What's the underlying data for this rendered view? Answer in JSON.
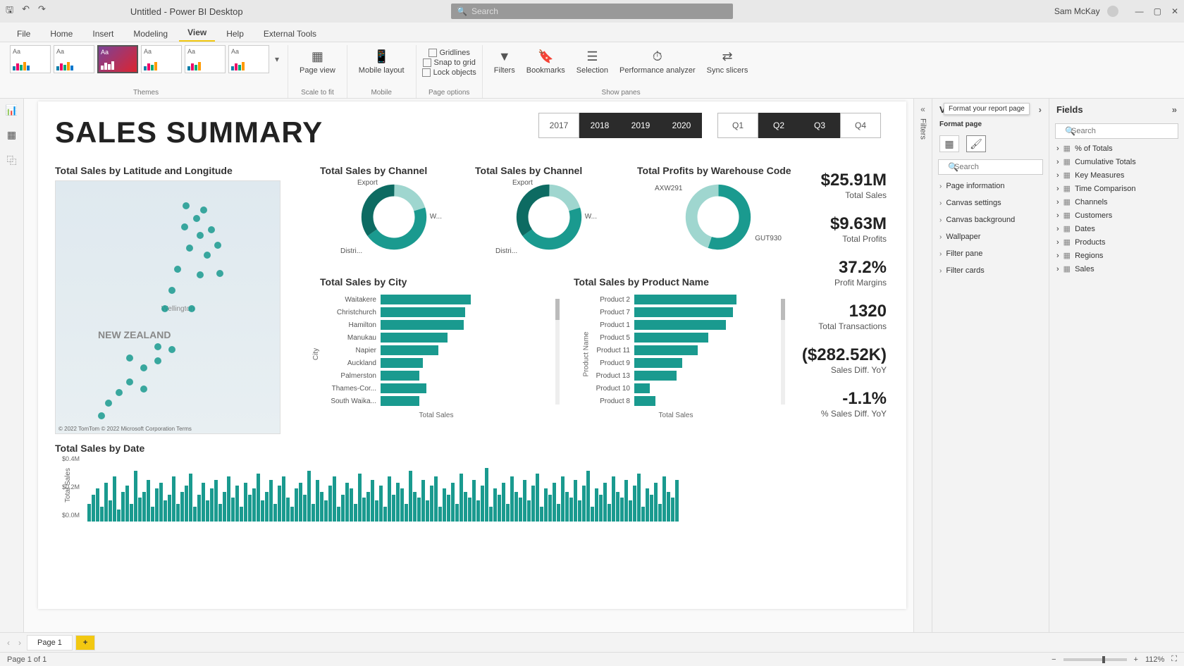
{
  "titlebar": {
    "title": "Untitled - Power BI Desktop",
    "search_placeholder": "Search",
    "user": "Sam McKay"
  },
  "menubar": {
    "tabs": [
      "File",
      "Home",
      "Insert",
      "Modeling",
      "View",
      "Help",
      "External Tools"
    ],
    "active": "View"
  },
  "ribbon": {
    "themes_label": "Themes",
    "page_view": "Page view",
    "scale_label": "Scale to fit",
    "mobile_layout": "Mobile layout",
    "mobile_label": "Mobile",
    "gridlines": "Gridlines",
    "snap": "Snap to grid",
    "lock": "Lock objects",
    "page_options_label": "Page options",
    "filters": "Filters",
    "bookmarks": "Bookmarks",
    "selection": "Selection",
    "perf": "Performance analyzer",
    "sync": "Sync slicers",
    "show_panes_label": "Show panes"
  },
  "report": {
    "title": "SALES SUMMARY",
    "years": [
      "2017",
      "2018",
      "2019",
      "2020"
    ],
    "years_active": [
      "2018",
      "2019",
      "2020"
    ],
    "quarters": [
      "Q1",
      "Q2",
      "Q3",
      "Q4"
    ],
    "quarters_active": [
      "Q2",
      "Q3"
    ],
    "map_title": "Total Sales by Latitude and Longitude",
    "map_country": "NEW ZEALAND",
    "map_city": "Wellington",
    "map_attrib": "© 2022 TomTom  © 2022 Microsoft Corporation  Terms",
    "donut1": {
      "title": "Total Sales by Channel",
      "labels": [
        "Export",
        "W...",
        "Distri..."
      ]
    },
    "donut2": {
      "title": "Total Sales by Channel",
      "labels": [
        "Export",
        "W...",
        "Distri..."
      ]
    },
    "donut3": {
      "title": "Total Profits by Warehouse Code",
      "labels": [
        "AXW291",
        "GUT930"
      ]
    },
    "kpis": [
      {
        "val": "$25.91M",
        "lbl": "Total Sales"
      },
      {
        "val": "$9.63M",
        "lbl": "Total Profits"
      },
      {
        "val": "37.2%",
        "lbl": "Profit Margins"
      },
      {
        "val": "1320",
        "lbl": "Total Transactions"
      },
      {
        "val": "($282.52K)",
        "lbl": "Sales Diff. YoY"
      },
      {
        "val": "-1.1%",
        "lbl": "% Sales Diff. YoY"
      }
    ],
    "city_title": "Total Sales by City",
    "city_axis_v": "City",
    "city_axis_h": "Total Sales",
    "product_title": "Total Sales by Product Name",
    "product_axis_v": "Product Name",
    "product_axis_h": "Total Sales",
    "date_title": "Total Sales by Date",
    "date_axis_v": "Total Sales",
    "date_yticks": [
      "$0.4M",
      "$0.2M",
      "$0.0M"
    ]
  },
  "chart_data": {
    "city_bars": {
      "type": "bar",
      "orientation": "horizontal",
      "categories": [
        "Waitakere",
        "Christchurch",
        "Hamilton",
        "Manukau",
        "Napier",
        "Auckland",
        "Palmerston",
        "Thames-Cor...",
        "South Waika..."
      ],
      "values": [
        128,
        120,
        118,
        95,
        82,
        60,
        55,
        65,
        55
      ],
      "xlabel": "Total Sales",
      "ylabel": "City"
    },
    "product_bars": {
      "type": "bar",
      "orientation": "horizontal",
      "categories": [
        "Product 2",
        "Product 7",
        "Product 1",
        "Product 5",
        "Product 11",
        "Product 9",
        "Product 13",
        "Product 10",
        "Product 8"
      ],
      "values": [
        145,
        140,
        130,
        105,
        90,
        68,
        60,
        22,
        30
      ],
      "xlabel": "Total Sales",
      "ylabel": "Product Name"
    },
    "donut_channel": {
      "type": "pie",
      "categories": [
        "Export",
        "Wholesale",
        "Distributor"
      ],
      "values": [
        20,
        45,
        35
      ]
    },
    "donut_warehouse": {
      "type": "pie",
      "categories": [
        "AXW291",
        "GUT930"
      ],
      "values": [
        55,
        45
      ]
    },
    "date_columns": {
      "type": "bar",
      "title": "Total Sales by Date",
      "ylabel": "Total Sales",
      "ylim": [
        0,
        0.4
      ],
      "y_unit": "$M",
      "values": [
        0.12,
        0.18,
        0.22,
        0.1,
        0.26,
        0.14,
        0.3,
        0.08,
        0.2,
        0.24,
        0.12,
        0.34,
        0.16,
        0.2,
        0.28,
        0.1,
        0.22,
        0.26,
        0.14,
        0.18,
        0.3,
        0.12,
        0.2,
        0.24,
        0.32,
        0.1,
        0.18,
        0.26,
        0.14,
        0.22,
        0.28,
        0.12,
        0.2,
        0.3,
        0.16,
        0.24,
        0.1,
        0.26,
        0.18,
        0.22,
        0.32,
        0.14,
        0.2,
        0.28,
        0.12,
        0.24,
        0.3,
        0.16,
        0.1,
        0.22,
        0.26,
        0.18,
        0.34,
        0.12,
        0.28,
        0.2,
        0.14,
        0.24,
        0.3,
        0.1,
        0.18,
        0.26,
        0.22,
        0.12,
        0.32,
        0.16,
        0.2,
        0.28,
        0.14,
        0.24,
        0.1,
        0.3,
        0.18,
        0.26,
        0.22,
        0.12,
        0.34,
        0.2,
        0.16,
        0.28,
        0.14,
        0.24,
        0.3,
        0.1,
        0.22,
        0.18,
        0.26,
        0.12,
        0.32,
        0.2,
        0.16,
        0.28,
        0.14,
        0.24,
        0.36,
        0.1,
        0.22,
        0.18,
        0.26,
        0.12,
        0.3,
        0.2,
        0.16,
        0.28,
        0.14,
        0.24,
        0.32,
        0.1,
        0.22,
        0.18,
        0.26,
        0.12,
        0.3,
        0.2,
        0.16,
        0.28,
        0.14,
        0.24,
        0.34,
        0.1,
        0.22,
        0.18,
        0.26,
        0.12,
        0.3,
        0.2,
        0.16,
        0.28,
        0.14,
        0.24,
        0.32,
        0.1,
        0.22,
        0.18,
        0.26,
        0.12,
        0.3,
        0.2,
        0.16,
        0.28
      ]
    }
  },
  "viz_pane": {
    "header": "V",
    "tooltip": "Format your report page",
    "subheader": "Format page",
    "search_placeholder": "Search",
    "sections": [
      "Page information",
      "Canvas settings",
      "Canvas background",
      "Wallpaper",
      "Filter pane",
      "Filter cards"
    ]
  },
  "fields_pane": {
    "header": "Fields",
    "search_placeholder": "Search",
    "tables": [
      "% of Totals",
      "Cumulative Totals",
      "Key Measures",
      "Time Comparison",
      "Channels",
      "Customers",
      "Dates",
      "Products",
      "Regions",
      "Sales"
    ]
  },
  "filters_collapsed": "Filters",
  "page_tabs": {
    "page1": "Page 1",
    "add": "+"
  },
  "statusbar": {
    "left": "Page 1 of 1",
    "zoom": "112%"
  }
}
